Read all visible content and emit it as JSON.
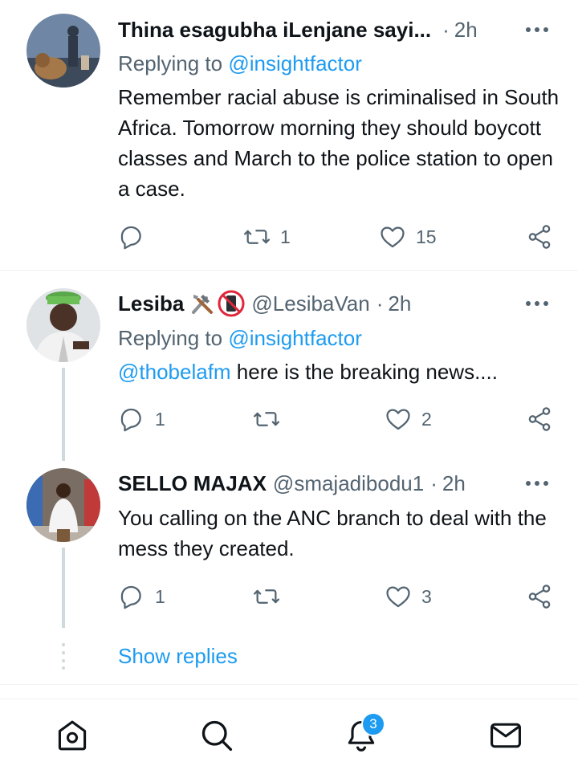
{
  "tweets": [
    {
      "name": "Thina esagubha iLenjane sayi...",
      "handle": "",
      "separator": "·",
      "time": "2h",
      "replying_prefix": "Replying to",
      "replying_to": "@insightfactor",
      "text": "Remember racial abuse is criminalised in South Africa. Tomorrow morning they should boycott classes and March to the police station to open a case.",
      "replies": "",
      "retweets": "1",
      "likes": "15"
    },
    {
      "name": "Lesiba",
      "name_emojis": [
        "hammer-wrench-emoji",
        "no-mobile-phones-emoji"
      ],
      "handle": "@LesibaVan",
      "separator": "·",
      "time": "2h",
      "replying_prefix": "Replying to",
      "replying_to": "@insightfactor",
      "text_mention": "@thobelafm",
      "text": " here is the breaking news....",
      "replies": "1",
      "retweets": "",
      "likes": "2"
    },
    {
      "name": "SELLO MAJAX",
      "handle": "@smajadibodu1",
      "separator": "·",
      "time": "2h",
      "text": "You calling  on the ANC branch to deal with the mess they created.",
      "replies": "1",
      "retweets": "",
      "likes": "3"
    }
  ],
  "show_replies": "Show replies",
  "nav": {
    "items": [
      "home-icon",
      "search-icon",
      "notifications-icon",
      "messages-icon"
    ],
    "notification_badge": "3"
  },
  "colors": {
    "accent": "#1d9bf0",
    "secondary_text": "#536471",
    "primary_text": "#0f1419",
    "thread_line": "#cfd9de"
  }
}
